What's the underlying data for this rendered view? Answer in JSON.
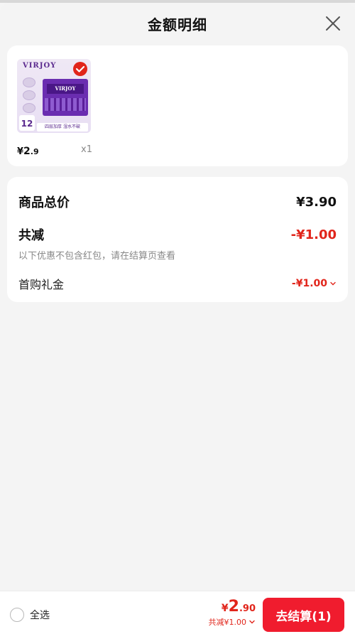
{
  "header": {
    "title": "金额明细"
  },
  "product": {
    "thumb_brand": "VIRJOY",
    "thumb_pack_label": "VIRJOY",
    "thumb_count": "12",
    "thumb_banner": "四层加厚 湿水不破",
    "price_yen": "¥",
    "price_int": "2",
    "price_dec": ".9",
    "quantity": "x1"
  },
  "summary": {
    "total_label": "商品总价",
    "total_value": "¥3.90",
    "reduce_label": "共减",
    "reduce_value": "-¥1.00",
    "note": "以下优惠不包含红包，请在结算页查看",
    "gift_label": "首购礼金",
    "gift_value": "-¥1.00"
  },
  "bottom": {
    "select_all": "全选",
    "price_yen": "¥",
    "price_int": "2",
    "price_dec": ".90",
    "reduce_text": "共减¥1.00",
    "checkout_label": "去结算(1)"
  },
  "colors": {
    "accent": "#e1251b",
    "checkout_bg": "#f01c2e"
  },
  "icons": [
    "close-icon",
    "check-icon",
    "chevron-down-icon"
  ]
}
